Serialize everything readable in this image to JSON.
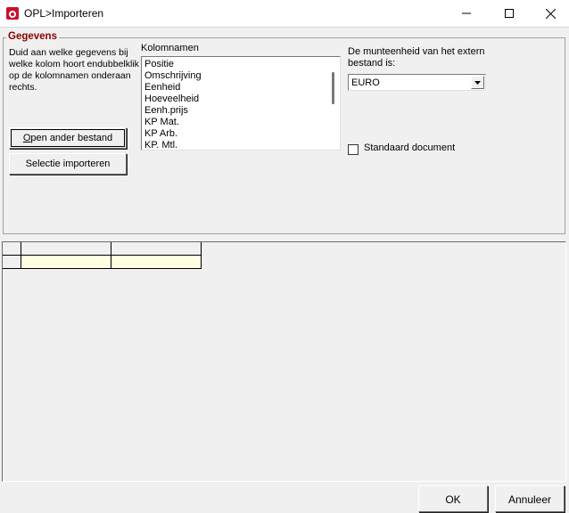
{
  "window": {
    "title": "OPL>Importeren"
  },
  "group": {
    "title": "Gegevens"
  },
  "instructions": "Duid aan welke gegevens bij welke kolom hoort endubbelklik op de kolomnamen onderaan rechts.",
  "buttons": {
    "open_prefix": "O",
    "open_rest": "pen ander bestand",
    "select": "Selectie importeren",
    "ok": "OK",
    "cancel": "Annuleer"
  },
  "columns": {
    "label": "Kolomnamen",
    "items": [
      "Positie",
      "Omschrijving",
      "Eenheid",
      "Hoeveelheid",
      "Eenh.prijs",
      "KP Mat.",
      "KP Arb.",
      "KP. Mtl."
    ]
  },
  "currency": {
    "label": "De munteenheid van het extern bestand is:",
    "value": "EURO"
  },
  "standard_doc": {
    "label": "Standaard document",
    "checked": false
  }
}
